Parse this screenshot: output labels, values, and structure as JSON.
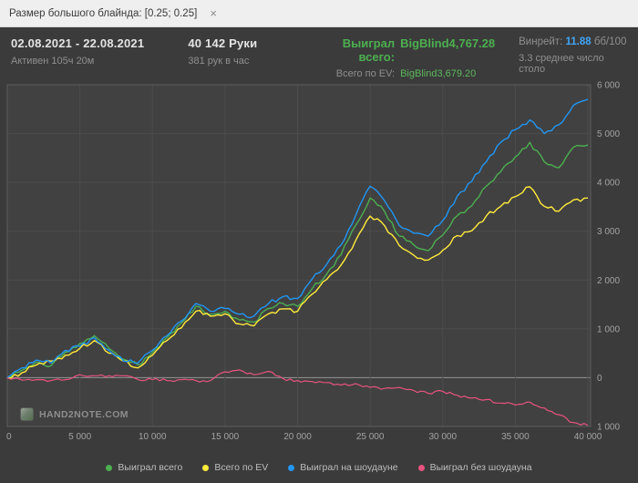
{
  "tab_bar": {
    "filter_label": "Размер большого блайнда: [0.25; 0.25]",
    "close_icon": "×"
  },
  "header": {
    "date_range": "02.08.2021 - 22.08.2021",
    "active_time": "Активен 105ч 20м",
    "hands_total": "40 142 Руки",
    "hands_per_hour": "381 рук в час",
    "won_total_label": "Выиграл всего:",
    "won_total_value": "BigBlind4,767.28",
    "ev_total_label": "Всего по EV:",
    "ev_total_value": "BigBlind3,679.20",
    "winrate_label": "Винрейт:",
    "winrate_value": "11.88",
    "winrate_unit": "бб/100",
    "avg_tables": "3.3 среднее число столо"
  },
  "chart_data": {
    "type": "line",
    "title": "",
    "xlabel": "",
    "ylabel": "",
    "x_start": 0,
    "x_step": 1000,
    "xlim": [
      0,
      40500
    ],
    "ylim": [
      -1000,
      6000
    ],
    "grid": true,
    "legend_position": "bottom",
    "x_ticks": {
      "values": [
        0,
        5000,
        10000,
        15000,
        20000,
        25000,
        30000,
        35000,
        40000
      ],
      "labels": [
        "0",
        "5 000",
        "10 000",
        "15 000",
        "20 000",
        "25 000",
        "30 000",
        "35 000",
        "40 000"
      ]
    },
    "y_ticks": {
      "values": [
        6000,
        5000,
        4000,
        3000,
        2000,
        1000,
        0,
        -1000
      ],
      "labels": [
        "6 000",
        "5 000",
        "4 000",
        "3 000",
        "2 000",
        "1 000",
        "0",
        "1 000"
      ]
    },
    "series": [
      {
        "id": "won-total",
        "name": "Выиграл всего",
        "color": "#4caf50",
        "width": 1.4,
        "jitter": 90,
        "values": [
          0,
          150,
          320,
          240,
          520,
          700,
          860,
          600,
          380,
          260,
          520,
          820,
          1120,
          1460,
          1300,
          1360,
          1180,
          1140,
          1420,
          1520,
          1460,
          1820,
          2120,
          2520,
          3120,
          3680,
          3400,
          2900,
          2720,
          2600,
          2920,
          3320,
          3520,
          3920,
          4220,
          4520,
          4820,
          4420,
          4300,
          4720,
          4767
        ]
      },
      {
        "id": "ev-total",
        "name": "Всего по EV",
        "color": "#ffeb3b",
        "width": 1.4,
        "jitter": 90,
        "values": [
          0,
          100,
          260,
          340,
          460,
          600,
          760,
          500,
          340,
          200,
          460,
          760,
          1020,
          1360,
          1260,
          1310,
          1100,
          1060,
          1310,
          1410,
          1360,
          1710,
          2010,
          2310,
          2810,
          3310,
          3110,
          2710,
          2510,
          2410,
          2610,
          2910,
          3010,
          3310,
          3510,
          3710,
          3910,
          3510,
          3410,
          3640,
          3679
        ]
      },
      {
        "id": "won-showdown",
        "name": "Выиграл на шоудауне",
        "color": "#2196f3",
        "width": 1.4,
        "jitter": 90,
        "values": [
          0,
          200,
          360,
          300,
          560,
          640,
          820,
          560,
          340,
          300,
          560,
          860,
          1160,
          1520,
          1360,
          1420,
          1300,
          1260,
          1520,
          1660,
          1620,
          2020,
          2320,
          2720,
          3320,
          3920,
          3620,
          3120,
          2960,
          2900,
          3220,
          3720,
          4020,
          4420,
          4820,
          5080,
          5280,
          5000,
          5180,
          5580,
          5700
        ]
      },
      {
        "id": "won-nonshowdown",
        "name": "Выиграл без шоудауна",
        "color": "#e8537f",
        "width": 1.2,
        "jitter": 60,
        "values": [
          0,
          -50,
          -40,
          -60,
          -40,
          60,
          40,
          40,
          40,
          -40,
          -40,
          -60,
          -40,
          -60,
          -60,
          120,
          160,
          60,
          130,
          -20,
          -60,
          -80,
          -100,
          -150,
          -120,
          -200,
          -220,
          -200,
          -260,
          -320,
          -280,
          -360,
          -420,
          -450,
          -520,
          -560,
          -500,
          -620,
          -760,
          -920,
          -980
        ]
      }
    ]
  },
  "legend": {
    "items": [
      {
        "label": "Выиграл всего",
        "color": "#4caf50"
      },
      {
        "label": "Всего по EV",
        "color": "#ffeb3b"
      },
      {
        "label": "Выиграл на шоудауне",
        "color": "#2196f3"
      },
      {
        "label": "Выиграл без шоудауна",
        "color": "#e8537f"
      }
    ]
  },
  "footer": {
    "logo_text": "HAND2NOTE.COM"
  }
}
